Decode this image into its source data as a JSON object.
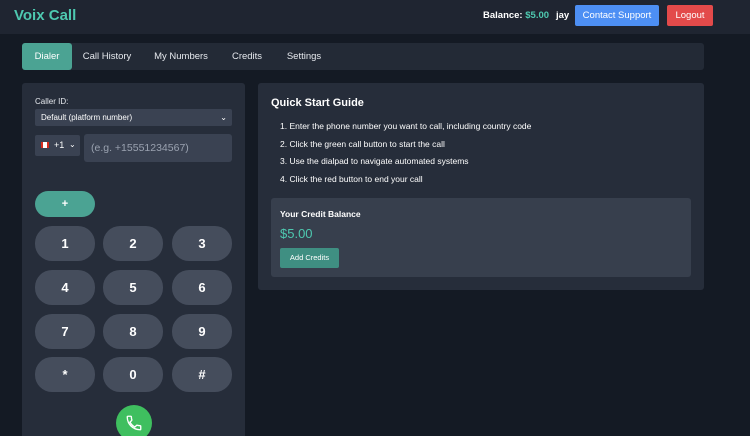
{
  "header": {
    "brand": "Voix Call",
    "balance_label": "Balance:",
    "balance_value": "$5.00",
    "username": "jay",
    "support_label": "Contact Support",
    "logout_label": "Logout"
  },
  "tabs": [
    {
      "label": "Dialer",
      "active": true
    },
    {
      "label": "Call History",
      "active": false
    },
    {
      "label": "My Numbers",
      "active": false
    },
    {
      "label": "Credits",
      "active": false
    },
    {
      "label": "Settings",
      "active": false
    }
  ],
  "dialer": {
    "caller_id_label": "Caller ID:",
    "caller_id_selected": "Default (platform number)",
    "country_code": "+1",
    "phone_placeholder": "(e.g. +15551234567)",
    "plus_label": "+",
    "keys": [
      "1",
      "2",
      "3",
      "4",
      "5",
      "6",
      "7",
      "8",
      "9",
      "*",
      "0",
      "#"
    ],
    "call_icon": "phone-icon"
  },
  "guide": {
    "title": "Quick Start Guide",
    "steps": [
      "1. Enter the phone number you want to call, including country code",
      "2. Click the green call button to start the call",
      "3. Use the dialpad to navigate automated systems",
      "4. Click the red button to end your call"
    ],
    "credit_title": "Your Credit Balance",
    "credit_amount": "$5.00",
    "add_credits_label": "Add Credits"
  },
  "colors": {
    "accent": "#4ec9b0",
    "tab_active": "#4ba393",
    "support": "#4d8ff4",
    "logout": "#e34a4a",
    "call": "#3fbf5f"
  }
}
